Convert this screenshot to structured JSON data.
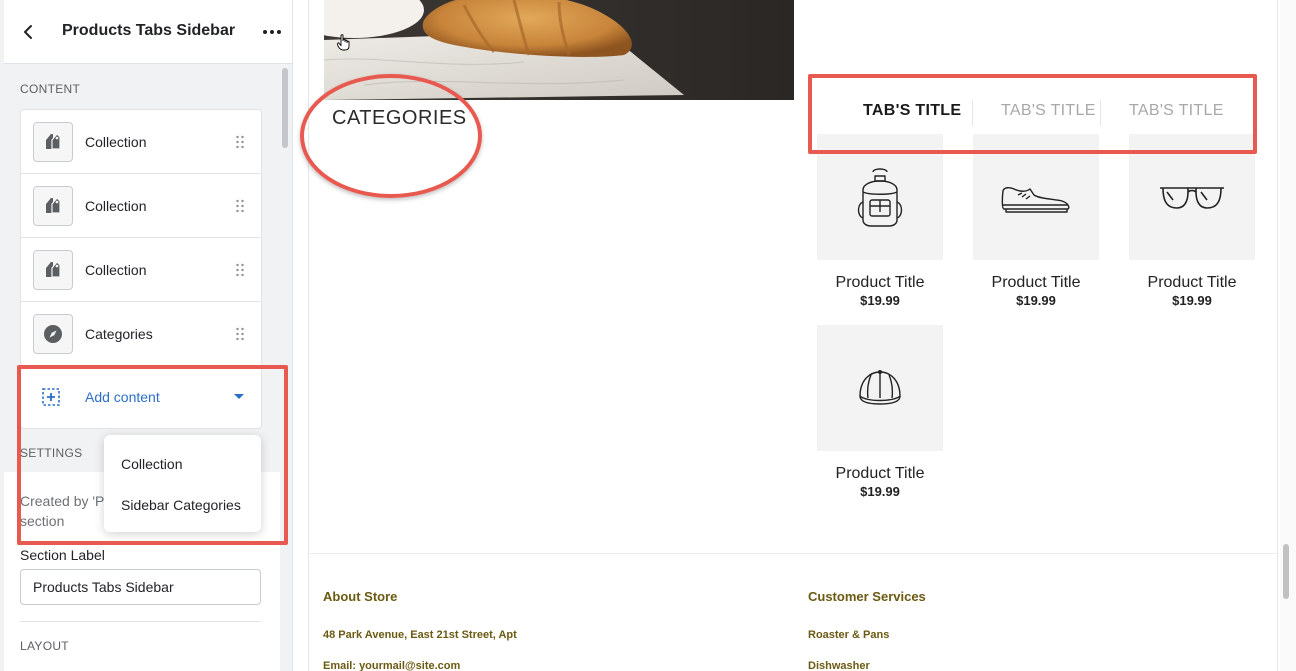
{
  "sidebar": {
    "title": "Products Tabs Sidebar",
    "content_label": "CONTENT",
    "items": [
      {
        "label": "Collection",
        "icon": "tag-icon"
      },
      {
        "label": "Collection",
        "icon": "tag-icon"
      },
      {
        "label": "Collection",
        "icon": "tag-icon"
      },
      {
        "label": "Categories",
        "icon": "compass-icon"
      }
    ],
    "add_content_label": "Add content",
    "settings_label": "SETTINGS",
    "created_by": "Created by 'P section",
    "section_label_title": "Section Label",
    "section_label_value": "Products Tabs Sidebar",
    "layout_label": "LAYOUT",
    "dropdown": [
      "Collection",
      "Sidebar Categories"
    ]
  },
  "preview": {
    "categories_title": "CATEGORIES",
    "tabs": [
      "TAB'S TITLE",
      "TAB'S TITLE",
      "TAB'S TITLE"
    ],
    "products": [
      {
        "title": "Product Title",
        "price": "$19.99",
        "icon": "backpack-icon"
      },
      {
        "title": "Product Title",
        "price": "$19.99",
        "icon": "sneaker-icon"
      },
      {
        "title": "Product Title",
        "price": "$19.99",
        "icon": "glasses-icon"
      },
      {
        "title": "Product Title",
        "price": "$19.99",
        "icon": "cap-icon"
      }
    ],
    "footer": {
      "col1_head": "About Store",
      "col1_line1": "48 Park Avenue, East 21st Street, Apt",
      "col1_line2": "Email: yourmail@site.com",
      "col2_head": "Customer Services",
      "col2_line1": "Roaster & Pans",
      "col2_line2": "Dishwasher"
    }
  },
  "colors": {
    "annotation": "#e8594f",
    "link": "#2c6ecb",
    "footer_text": "#6b5a12"
  }
}
